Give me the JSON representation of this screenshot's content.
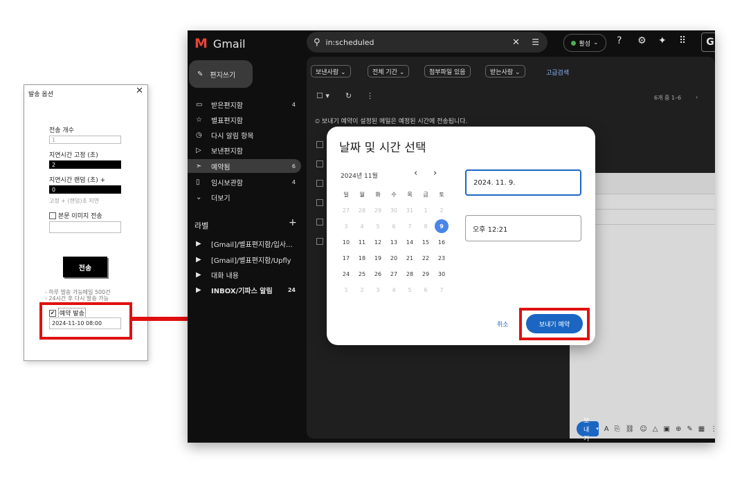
{
  "options_dialog": {
    "title": "발송 옵션",
    "close": "✕",
    "count_label": "전송 개수",
    "count_value": "1",
    "fixed_delay_label": "지연시간 고정 (초)",
    "fixed_delay_value": "2",
    "random_delay_label": "지연시간 랜덤 (초) +",
    "random_delay_value": "0",
    "delay_hint": "고정 + (랜덤)초 지연",
    "image_check_label": "본문 이미지 전송",
    "image_input_value": "",
    "send_button": "전송",
    "note1": "- 하루 발송 가능메일 500건",
    "note2": "- 24시간 후 다시 발송 가능",
    "schedule_check_label": "예약 발송",
    "schedule_check_mark": "✔",
    "schedule_value": "2024-11-10 08:00"
  },
  "gmail": {
    "app_name": "Gmail",
    "logo_letter": "M",
    "search_query": "in:scheduled",
    "search_icon": "search-icon",
    "status_label": "활성",
    "compose_label": "편지쓰기",
    "nav": [
      {
        "label": "받은편지함",
        "count": "4",
        "icon": "▭"
      },
      {
        "label": "별표편지함",
        "count": "",
        "icon": "☆"
      },
      {
        "label": "다시 알림 항목",
        "count": "",
        "icon": "◷"
      },
      {
        "label": "보낸편지함",
        "count": "",
        "icon": "▷"
      },
      {
        "label": "예약됨",
        "count": "6",
        "icon": "➣"
      },
      {
        "label": "임시보관함",
        "count": "4",
        "icon": "▯"
      },
      {
        "label": "더보기",
        "count": "",
        "icon": "⌄"
      }
    ],
    "labels_header": "라벨",
    "labels_plus": "+",
    "labels": [
      {
        "label": "[Gmail]/별표편지함/입사...",
        "count": ""
      },
      {
        "label": "[Gmail]/별표편지함/Upfly",
        "count": ""
      },
      {
        "label": "대화 내용",
        "count": ""
      },
      {
        "label": "INBOX/기파스 알림",
        "count": "24"
      }
    ],
    "filters": [
      "보낸사람 ⌄",
      "전체 기간 ⌄",
      "첨부파일 있음",
      "받는사람 ⌄"
    ],
    "advanced_search": "고급검색",
    "pager": "6개 중 1–6",
    "info_text": "보내기 예약이 설정된 메일은 예정된 시간에 전송됩니다.",
    "send_button": "보내기"
  },
  "datetime_modal": {
    "title": "날짜 및 시간 선택",
    "month_label": "2024년 11월",
    "weekdays": [
      "일",
      "월",
      "화",
      "수",
      "목",
      "금",
      "토"
    ],
    "weeks": [
      [
        "27",
        "28",
        "29",
        "30",
        "31",
        "1",
        "2"
      ],
      [
        "3",
        "4",
        "5",
        "6",
        "7",
        "8",
        "9"
      ],
      [
        "10",
        "11",
        "12",
        "13",
        "14",
        "15",
        "16"
      ],
      [
        "17",
        "18",
        "19",
        "20",
        "21",
        "22",
        "23"
      ],
      [
        "24",
        "25",
        "26",
        "27",
        "28",
        "29",
        "30"
      ],
      [
        "1",
        "2",
        "3",
        "4",
        "5",
        "6",
        "7"
      ]
    ],
    "selected_day": "9",
    "date_value": "2024. 11. 9.",
    "time_value": "오후 12:21",
    "cancel_label": "취소",
    "schedule_label": "보내기 예약"
  },
  "colors": {
    "highlight": "#e01010",
    "gmail_blue": "#1a66c2",
    "selected_day": "#4a86e8"
  }
}
